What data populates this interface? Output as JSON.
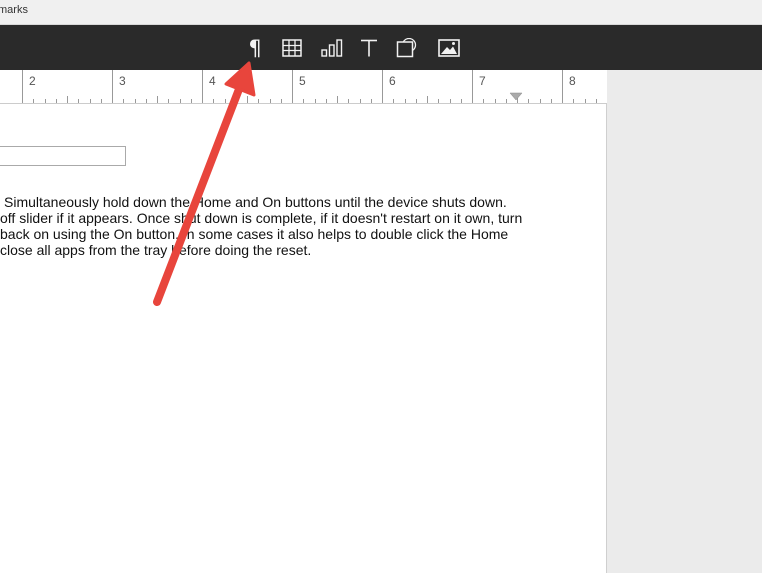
{
  "menubar": {
    "partial_item": "marks"
  },
  "toolbar": {
    "buttons": [
      {
        "name": "paragraph",
        "icon": "pilcrow-icon",
        "glyph": "¶"
      },
      {
        "name": "table",
        "icon": "table-icon"
      },
      {
        "name": "chart",
        "icon": "bar-chart-icon"
      },
      {
        "name": "text",
        "icon": "text-icon"
      },
      {
        "name": "shape",
        "icon": "shape-icon"
      },
      {
        "name": "media",
        "icon": "image-icon"
      }
    ]
  },
  "ruler": {
    "numbers": [
      "2",
      "3",
      "4",
      "5",
      "6",
      "7",
      "8"
    ]
  },
  "document": {
    "lines": [
      "Simultaneously hold down the Home and On buttons until the device shuts down.",
      "off slider if it appears. Once shut down is complete, if it doesn't restart on it own, turn",
      "back on using the On button. In some cases it also helps to double click the Home",
      "close all apps from the tray before doing the reset."
    ]
  },
  "colors": {
    "toolbar": "#2a2a2a",
    "arrow": "#e8453c",
    "page": "#ffffff",
    "canvas": "#ebebeb"
  }
}
